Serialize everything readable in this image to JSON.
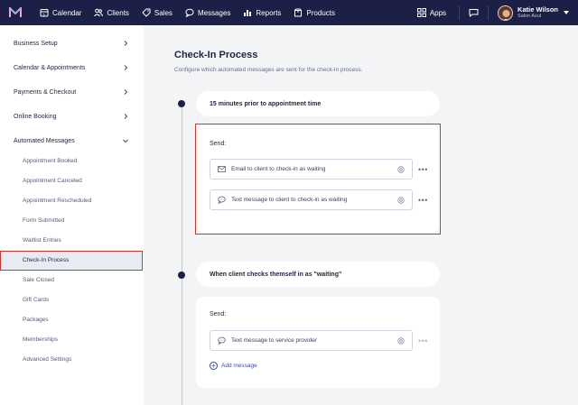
{
  "nav": {
    "items": [
      {
        "label": "Calendar",
        "icon": "calendar-icon"
      },
      {
        "label": "Clients",
        "icon": "clients-icon"
      },
      {
        "label": "Sales",
        "icon": "sales-tag-icon"
      },
      {
        "label": "Messages",
        "icon": "chat-bubble-icon"
      },
      {
        "label": "Reports",
        "icon": "bar-chart-icon"
      },
      {
        "label": "Products",
        "icon": "box-icon"
      }
    ],
    "apps_label": "Apps",
    "user_name": "Katie Wilson",
    "user_business": "Salon Azul"
  },
  "sidebar": {
    "sections": [
      {
        "label": "Business Setup"
      },
      {
        "label": "Calendar & Appointments"
      },
      {
        "label": "Payments & Checkout"
      },
      {
        "label": "Online Booking"
      },
      {
        "label": "Automated Messages"
      }
    ],
    "sub_items": [
      {
        "label": "Appointment Booked"
      },
      {
        "label": "Appointment Canceled"
      },
      {
        "label": "Appointment Rescheduled"
      },
      {
        "label": "Form Submitted"
      },
      {
        "label": "Waitlist Entries"
      },
      {
        "label": "Check-In Process",
        "active": true
      },
      {
        "label": "Sale Closed"
      },
      {
        "label": "Gift Cards"
      },
      {
        "label": "Packages"
      },
      {
        "label": "Memberships"
      },
      {
        "label": "Advanced Settings"
      }
    ]
  },
  "main": {
    "title": "Check-In Process",
    "description": "Configure which automated messages are sent for the check-in process.",
    "steps": [
      {
        "trigger": "15 minutes prior to appointment time",
        "send_label": "Send:",
        "messages": [
          {
            "label": "Email to client to check-in as waiting",
            "icon": "envelope-icon"
          },
          {
            "label": "Text message to client to check-in as waiting",
            "icon": "chat-bubble-icon"
          }
        ]
      },
      {
        "trigger": "When client checks themself in as \"waiting\"",
        "send_label": "Send:",
        "messages": [
          {
            "label": "Text message to service provider",
            "icon": "chat-bubble-icon"
          }
        ],
        "add_label": "Add message"
      }
    ]
  },
  "colors": {
    "nav_bg": "#1c2046",
    "highlight": "#e0302a",
    "link": "#3b48a8"
  }
}
